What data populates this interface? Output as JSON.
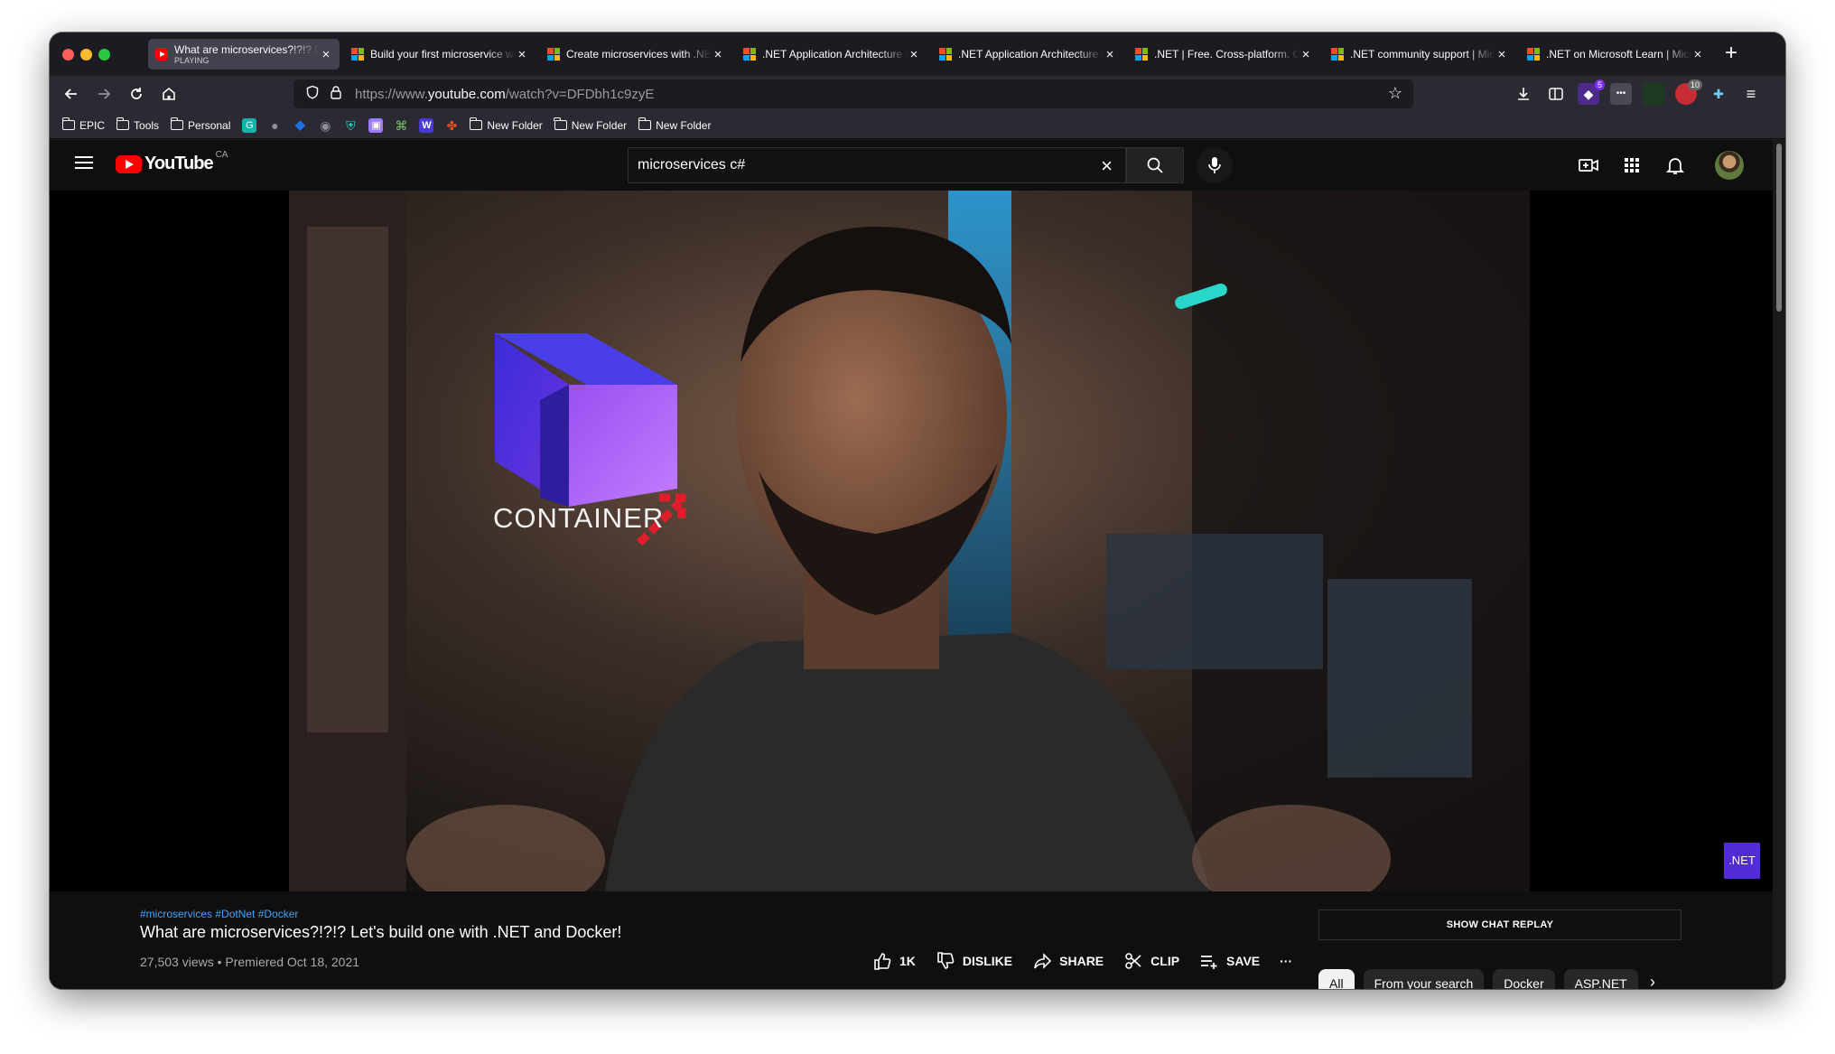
{
  "browser": {
    "tabs": [
      {
        "title": "What are microservices?!?!? Let's build one",
        "subtitle": "PLAYING",
        "favicon": "youtube-icon",
        "active": true
      },
      {
        "title": "Build your first microservice with .NET",
        "favicon": "microsoft-icon"
      },
      {
        "title": "Create microservices with .NET",
        "favicon": "microsoft-icon"
      },
      {
        "title": ".NET Application Architecture Guides",
        "favicon": "microsoft-icon"
      },
      {
        "title": ".NET Application Architecture Guides",
        "favicon": "microsoft-icon"
      },
      {
        "title": ".NET | Free. Cross-platform. Open Source.",
        "favicon": "microsoft-icon"
      },
      {
        "title": ".NET community support | Microsoft",
        "favicon": "microsoft-icon"
      },
      {
        "title": ".NET on Microsoft Learn | Microsoft",
        "favicon": "microsoft-icon"
      }
    ],
    "url": {
      "prefix": "https://www.",
      "domain": "youtube.com",
      "path": "/watch?v=DFDbh1c9zyE"
    },
    "extension_badges": {
      "tabs": "5",
      "adblock": "10"
    },
    "bookmarks": [
      {
        "type": "folder",
        "label": "EPIC"
      },
      {
        "type": "folder",
        "label": "Tools"
      },
      {
        "type": "folder",
        "label": "Personal"
      },
      {
        "type": "folder",
        "label": "New Folder"
      },
      {
        "type": "folder",
        "label": "New Folder"
      },
      {
        "type": "folder",
        "label": "New Folder"
      }
    ],
    "colors": {
      "frame": "#1c1b22",
      "toolbar": "#2b2a33",
      "active_tab": "#42414d"
    }
  },
  "youtube": {
    "logo_text": "YouTube",
    "country_code": "CA",
    "search_value": "microservices c#",
    "video": {
      "overlay_text": "CONTAINER",
      "channel_badge": ".NET",
      "hashtags": "#microservices #DotNet #Docker",
      "title": "What are microservices?!?!? Let's build one with .NET and Docker!",
      "meta": "27,503 views • Premiered Oct 18, 2021"
    },
    "actions": {
      "like": "1K",
      "dislike": "DISLIKE",
      "share": "SHARE",
      "clip": "CLIP",
      "save": "SAVE",
      "more": "···"
    },
    "chat_replay": "SHOW CHAT REPLAY",
    "chips": [
      "All",
      "From your search",
      "Docker",
      "ASP.NET"
    ],
    "colors": {
      "brand": "#ff0000",
      "background": "#0f0f0f",
      "link": "#3ea6ff",
      "dotnet": "#512bd4"
    }
  }
}
